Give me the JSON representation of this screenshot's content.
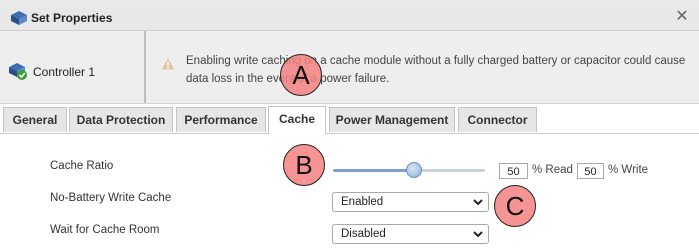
{
  "dialog": {
    "title": "Set Properties",
    "close_glyph": "✕",
    "controller_label": "Controller 1",
    "warning_text": "Enabling write caching on a cache module without a fully charged battery or capacitor could cause data loss in the event of a power failure."
  },
  "tabs": [
    {
      "label": "General",
      "active": false
    },
    {
      "label": "Data Protection",
      "active": false
    },
    {
      "label": "Performance",
      "active": false
    },
    {
      "label": "Cache",
      "active": true
    },
    {
      "label": "Power Management",
      "active": false
    },
    {
      "label": "Connector",
      "active": false
    }
  ],
  "cache": {
    "ratio_label": "Cache Ratio",
    "read_value": "50",
    "read_suffix": "% Read",
    "write_value": "50",
    "write_suffix": "% Write",
    "slider_fraction": 0.5,
    "no_battery_label": "No-Battery Write Cache",
    "no_battery_value": "Enabled",
    "wait_room_label": "Wait for Cache Room",
    "wait_room_value": "Disabled"
  },
  "markers": [
    "A",
    "B",
    "C"
  ],
  "icons": {
    "title": "controller-icon",
    "controller": "controller-ok-icon",
    "warning": "warning-icon",
    "close": "close-icon",
    "dropdown": "chevron-down-icon"
  },
  "colors": {
    "marker": "#f48080",
    "ok_green": "#3aa03a",
    "accent_blue": "#3b6fb0"
  }
}
